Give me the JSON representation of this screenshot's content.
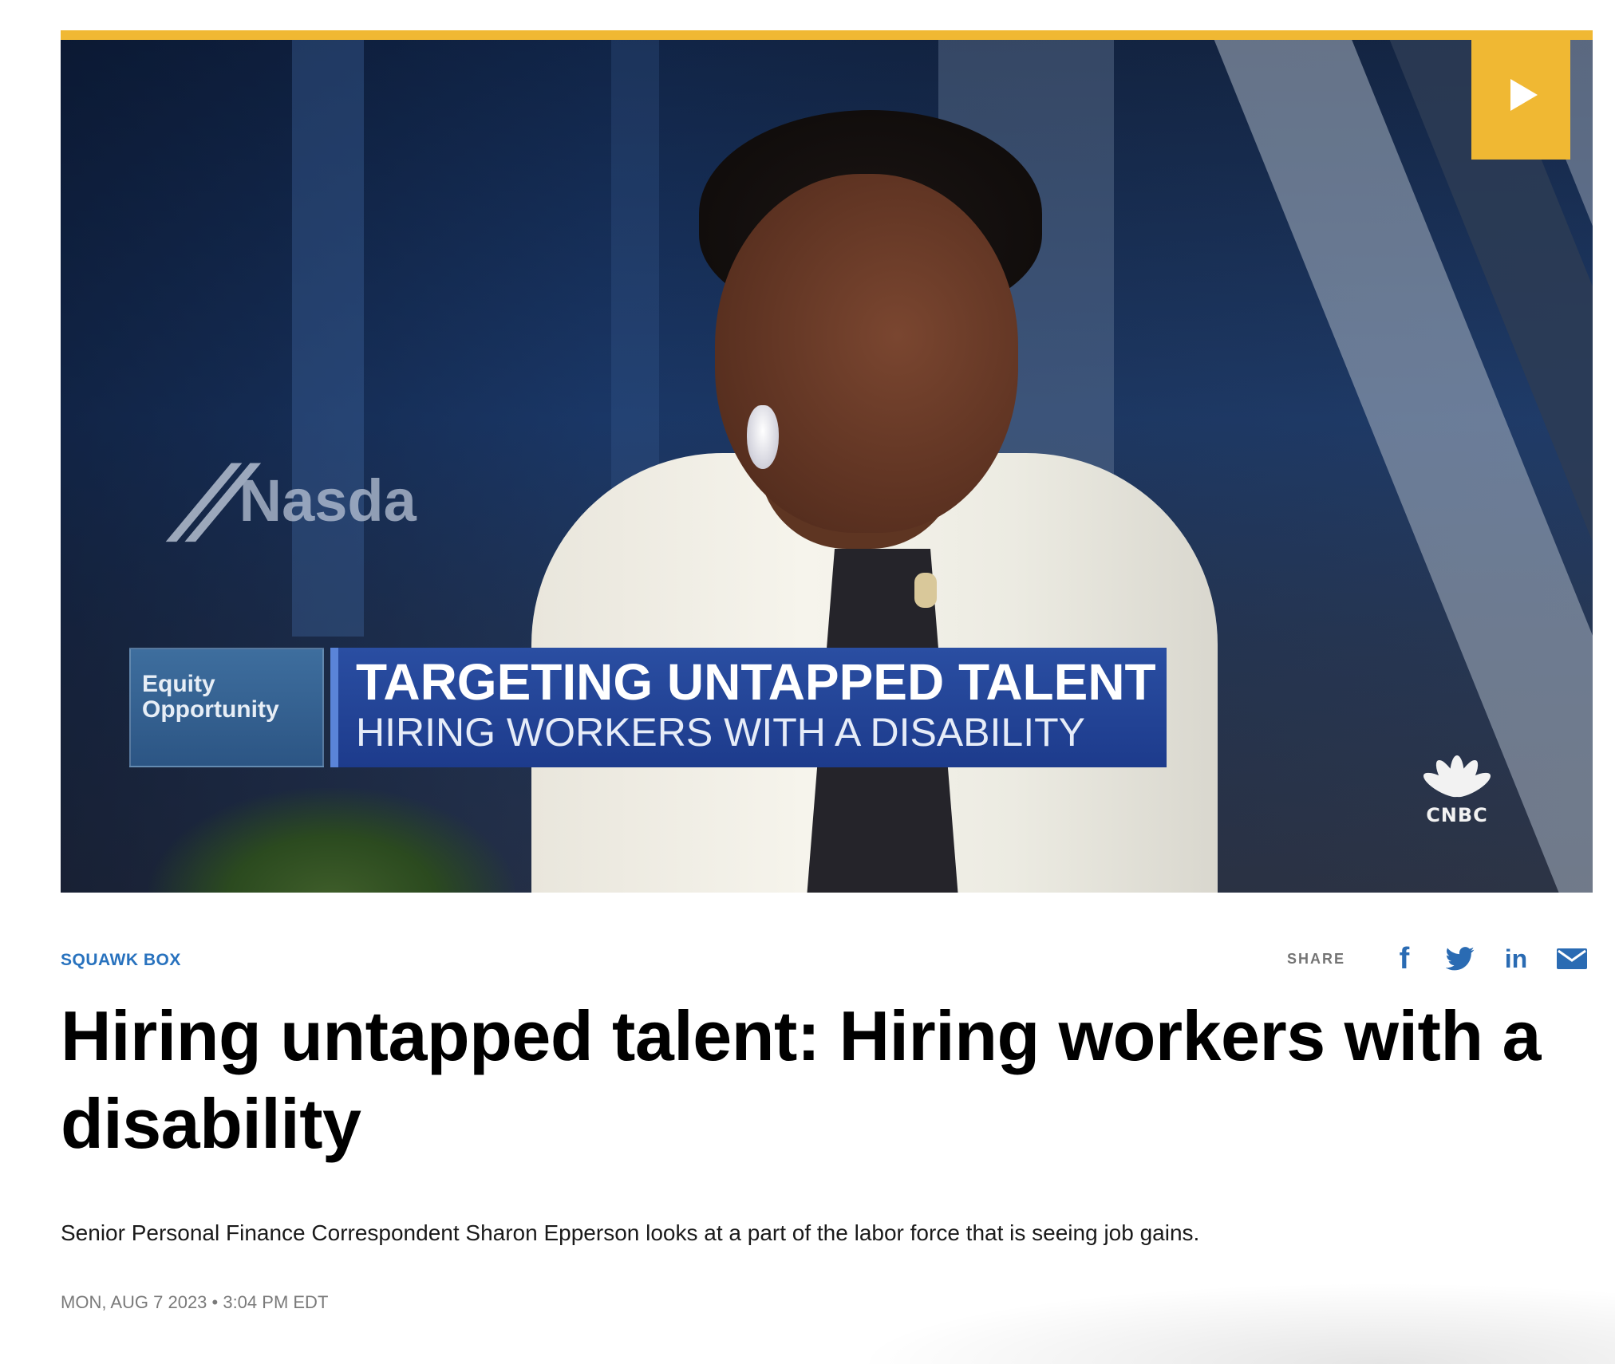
{
  "video": {
    "lower_third": {
      "brand_line1": "Equity",
      "brand_line2": "Opportunity",
      "headline": "TARGETING UNTAPPED TALENT",
      "subheadline": "HIRING WORKERS WITH A DISABILITY"
    },
    "background_logo_text": "Nasda",
    "network_logo_text": "CNBC",
    "play_icon": "play-icon",
    "accent_color": "#f0b833"
  },
  "article": {
    "show": "SQUAWK BOX",
    "share": {
      "label": "SHARE",
      "icons": [
        "facebook-icon",
        "twitter-icon",
        "linkedin-icon",
        "email-icon"
      ]
    },
    "title": "Hiring untapped talent: Hiring workers with a disability",
    "description": "Senior Personal Finance Correspondent Sharon Epperson looks at a part of the labor force that is seeing job gains.",
    "dateline": "MON, AUG 7 2023 • 3:04 PM EDT",
    "link_color": "#2872be",
    "share_icon_color": "#2a6bb3"
  }
}
